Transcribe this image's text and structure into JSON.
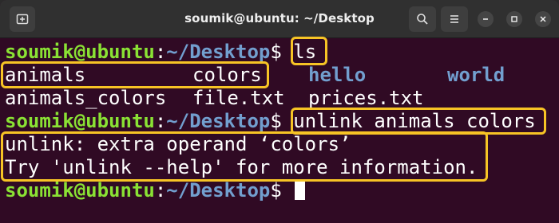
{
  "window": {
    "title": "soumik@ubuntu: ~/Desktop",
    "new_tab_icon": "new-tab-icon",
    "search_icon": "search-icon",
    "menu_icon": "hamburger-menu-icon",
    "minimize_icon": "minimize-icon",
    "maximize_icon": "maximize-icon",
    "close_icon": "close-icon"
  },
  "prompt": {
    "user_host": "soumik@ubuntu",
    "colon": ":",
    "path": "~/Desktop",
    "dollar": "$"
  },
  "commands": {
    "ls": "ls",
    "unlink": "unlink animals colors"
  },
  "ls_output": {
    "row1": [
      "animals",
      "colors",
      "hello",
      "world"
    ],
    "row2": [
      "animals_colors",
      "file.txt",
      "prices.txt"
    ]
  },
  "error_output": {
    "line1": "unlink: extra operand ‘colors’",
    "line2": "Try 'unlink --help' for more information."
  },
  "colors": {
    "background": "#300a24",
    "prompt_user": "#8ae234",
    "prompt_path": "#729fcf",
    "directory": "#729fcf",
    "highlight": "#f7c425"
  }
}
